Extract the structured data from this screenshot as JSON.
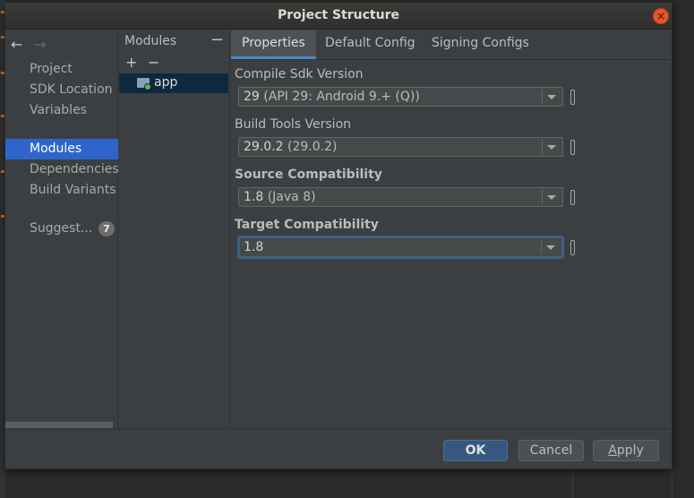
{
  "dialog": {
    "title": "Project Structure",
    "close_glyph": "×"
  },
  "nav": {
    "back_glyph": "←",
    "forward_glyph": "→",
    "items": [
      {
        "label": "Project"
      },
      {
        "label": "SDK Location"
      },
      {
        "label": "Variables"
      },
      {
        "label": "Modules",
        "selected": true
      },
      {
        "label": "Dependencies"
      },
      {
        "label": "Build Variants"
      }
    ],
    "suggestions": {
      "label": "Suggest...",
      "badge": "7"
    }
  },
  "modules": {
    "header": "Modules",
    "collapse_glyph": "−",
    "add_glyph": "+",
    "remove_glyph": "−",
    "items": [
      {
        "label": "app",
        "icon": "module-folder-icon"
      }
    ]
  },
  "tabs": [
    {
      "label": "Properties",
      "active": true
    },
    {
      "label": "Default Config"
    },
    {
      "label": "Signing Configs"
    }
  ],
  "fields": [
    {
      "label": "Compile Sdk Version",
      "bold": false,
      "value": "29",
      "hint": " (API 29: Android 9.+ (Q))"
    },
    {
      "label": "Build Tools Version",
      "bold": false,
      "value": "29.0.2",
      "hint": " (29.0.2)"
    },
    {
      "label": "Source Compatibility",
      "bold": true,
      "value": "1.8",
      "hint": " (Java 8)"
    },
    {
      "label": "Target Compatibility",
      "bold": true,
      "value": "1.8",
      "hint": "",
      "focused": true
    }
  ],
  "footer": {
    "ok": "OK",
    "cancel": "Cancel",
    "apply_mnemonic": "A",
    "apply_rest": "pply"
  },
  "colors": {
    "accent": "#2f65ca",
    "default_button": "#365880",
    "focus_ring": "#3d6185",
    "close": "#e0572b"
  }
}
